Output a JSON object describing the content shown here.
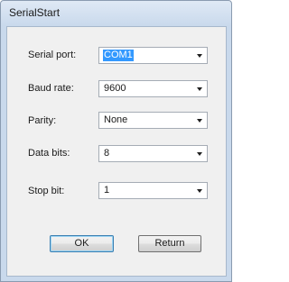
{
  "window": {
    "title": "SerialStart"
  },
  "form": {
    "serial_port": {
      "label": "Serial port:",
      "value": "COM1"
    },
    "baud_rate": {
      "label": "Baud rate:",
      "value": "9600"
    },
    "parity": {
      "label": "Parity:",
      "value": "None"
    },
    "data_bits": {
      "label": "Data bits:",
      "value": "8"
    },
    "stop_bit": {
      "label": "Stop bit:",
      "value": "1"
    }
  },
  "buttons": {
    "ok_label": "OK",
    "return_label": "Return"
  },
  "icons": {
    "dropdown": "chevron-down-icon"
  },
  "colors": {
    "selection": "#3399ff",
    "title_bar": "#c9d9ec",
    "client_background": "#f0f0f0"
  }
}
